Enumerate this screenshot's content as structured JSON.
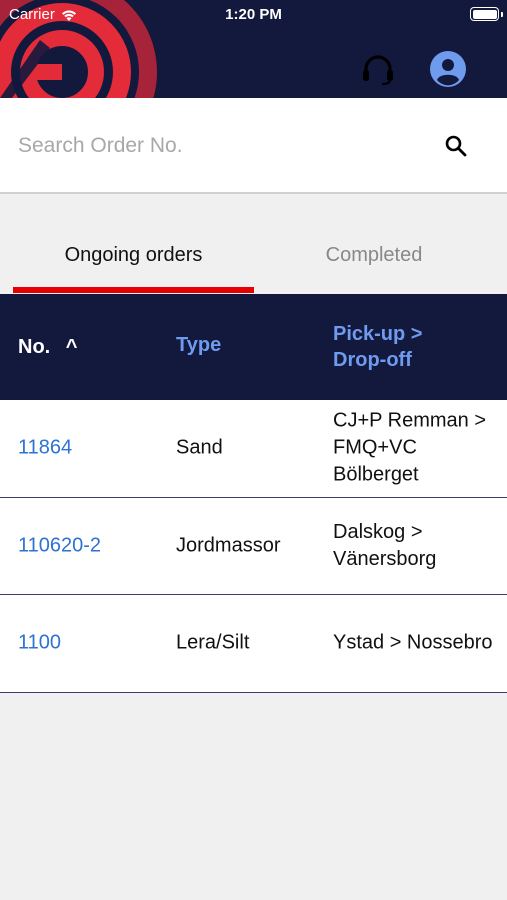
{
  "status_bar": {
    "carrier": "Carrier",
    "time": "1:20 PM"
  },
  "header": {
    "brand_color": "#13183d",
    "logo_color": "#e32b3a",
    "support_icon": "headset-icon",
    "profile_icon": "account-circle-icon",
    "profile_icon_color": "#6f9bef"
  },
  "search": {
    "placeholder": "Search Order No.",
    "value": "",
    "icon": "search-icon"
  },
  "tabs": [
    {
      "label": "Ongoing orders",
      "active": true
    },
    {
      "label": "Completed",
      "active": false
    }
  ],
  "tab_indicator_color": "#e80000",
  "table": {
    "headers": {
      "no": "No.",
      "sort_indicator": "^",
      "type": "Type",
      "route_line1": "Pick-up >",
      "route_line2": "Drop-off"
    },
    "rows": [
      {
        "no": "11864",
        "type": "Sand",
        "route": "CJ+P Remman > FMQ+VC Bölberget"
      },
      {
        "no": "110620-2",
        "type": "Jordmassor",
        "route": "Dalskog > Vänersborg"
      },
      {
        "no": "1100",
        "type": "Lera/Silt",
        "route": "Ystad > Nossebro"
      }
    ],
    "link_color": "#2e72d2"
  }
}
